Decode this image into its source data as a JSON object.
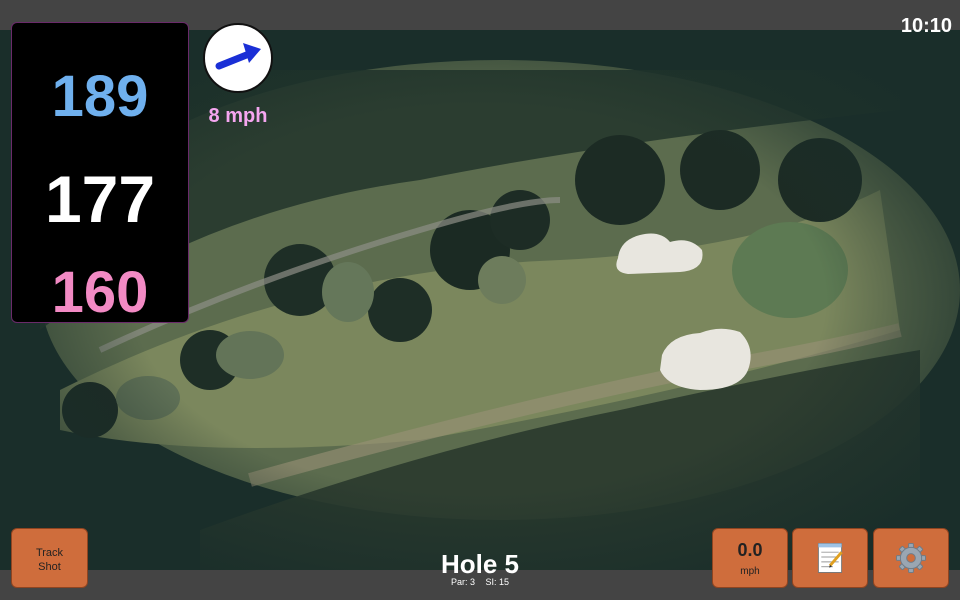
{
  "status": {
    "clock": "10:10"
  },
  "yardages": {
    "back": "189",
    "middle": "177",
    "front": "160"
  },
  "wind": {
    "speed": "8 mph",
    "direction_icon": "wind-arrow-icon"
  },
  "hole": {
    "title": "Hole 5",
    "par": "Par: 3",
    "stroke_index": "SI: 15"
  },
  "buttons": {
    "track_shot": {
      "line1": "Track",
      "line2": "Shot"
    },
    "speed": {
      "value": "0.0",
      "unit": "mph"
    },
    "notes": {
      "icon": "notepad-icon"
    },
    "settings": {
      "icon": "gear-icon"
    }
  },
  "colors": {
    "back": "#6fb0ee",
    "middle": "#ffffff",
    "front": "#f28ac4",
    "wind_text": "#f5a6f0",
    "button": "#cf6d3c"
  }
}
